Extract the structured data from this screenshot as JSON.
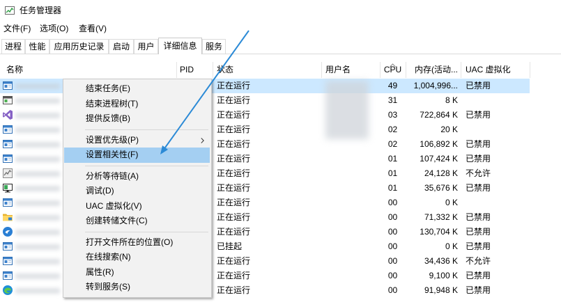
{
  "window": {
    "title": "任务管理器"
  },
  "icons": {
    "window": "task-manager-icon",
    "sort": "chevron-up-icon",
    "submenu": "chevron-right-icon"
  },
  "colors": {
    "selection": "#cce8ff",
    "menu_highlight": "#a4cff2",
    "menu_background": "#f2f2f2",
    "annotation_arrow": "#2b8ad6"
  },
  "menubar": {
    "items": [
      "文件(F)",
      "选项(O)",
      "查看(V)"
    ]
  },
  "tabs": [
    {
      "label": "进程"
    },
    {
      "label": "性能"
    },
    {
      "label": "应用历史记录"
    },
    {
      "label": "启动"
    },
    {
      "label": "用户"
    },
    {
      "label": "详细信息",
      "selected": true
    },
    {
      "label": "服务"
    }
  ],
  "table": {
    "columns": [
      "名称",
      "PID",
      "状态",
      "用户名",
      "CPU",
      "内存(活动...",
      "UAC 虚拟化"
    ],
    "rows": [
      {
        "icon": "app-window-icon",
        "status": "正在运行",
        "cpu": "49",
        "memory": "1,004,996...",
        "uac": "已禁用",
        "selected": true
      },
      {
        "icon": "gray-window-icon",
        "status": "正在运行",
        "cpu": "31",
        "memory": "8 K",
        "uac": ""
      },
      {
        "icon": "visual-studio-icon",
        "status": "正在运行",
        "cpu": "03",
        "memory": "722,864 K",
        "uac": "已禁用"
      },
      {
        "icon": "app-window-icon",
        "status": "正在运行",
        "cpu": "02",
        "memory": "20 K",
        "uac": ""
      },
      {
        "icon": "app-window-icon",
        "status": "正在运行",
        "cpu": "02",
        "memory": "106,892 K",
        "uac": "已禁用"
      },
      {
        "icon": "app-window-icon",
        "status": "正在运行",
        "cpu": "01",
        "memory": "107,424 K",
        "uac": "已禁用"
      },
      {
        "icon": "resource-monitor-icon",
        "status": "正在运行",
        "cpu": "01",
        "memory": "24,128 K",
        "uac": "不允许"
      },
      {
        "icon": "monitor-icon",
        "status": "正在运行",
        "cpu": "01",
        "memory": "35,676 K",
        "uac": "已禁用"
      },
      {
        "icon": "app-window-icon",
        "status": "正在运行",
        "cpu": "00",
        "memory": "0 K",
        "uac": ""
      },
      {
        "icon": "folder-icon",
        "status": "正在运行",
        "cpu": "00",
        "memory": "71,332 K",
        "uac": "已禁用"
      },
      {
        "icon": "blue-circle-icon",
        "status": "正在运行",
        "cpu": "00",
        "memory": "130,704 K",
        "uac": "已禁用"
      },
      {
        "icon": "app-window-icon",
        "status": "已挂起",
        "cpu": "00",
        "memory": "0 K",
        "uac": "已禁用"
      },
      {
        "icon": "app-window-icon",
        "status": "正在运行",
        "cpu": "00",
        "memory": "34,436 K",
        "uac": "不允许"
      },
      {
        "icon": "app-window-icon",
        "status": "正在运行",
        "cpu": "00",
        "memory": "9,100 K",
        "uac": "已禁用"
      },
      {
        "icon": "edge-icon",
        "status": "正在运行",
        "cpu": "00",
        "memory": "91,948 K",
        "uac": "已禁用"
      }
    ]
  },
  "context_menu": {
    "groups": [
      [
        {
          "label": "结束任务(E)"
        },
        {
          "label": "结束进程树(T)"
        },
        {
          "label": "提供反馈(B)"
        }
      ],
      [
        {
          "label": "设置优先级(P)",
          "submenu": true
        },
        {
          "label": "设置相关性(F)",
          "highlighted": true
        }
      ],
      [
        {
          "label": "分析等待链(A)"
        },
        {
          "label": "调试(D)"
        },
        {
          "label": "UAC 虚拟化(V)"
        },
        {
          "label": "创建转储文件(C)"
        }
      ],
      [
        {
          "label": "打开文件所在的位置(O)"
        },
        {
          "label": "在线搜索(N)"
        },
        {
          "label": "属性(R)"
        },
        {
          "label": "转到服务(S)"
        }
      ]
    ]
  }
}
